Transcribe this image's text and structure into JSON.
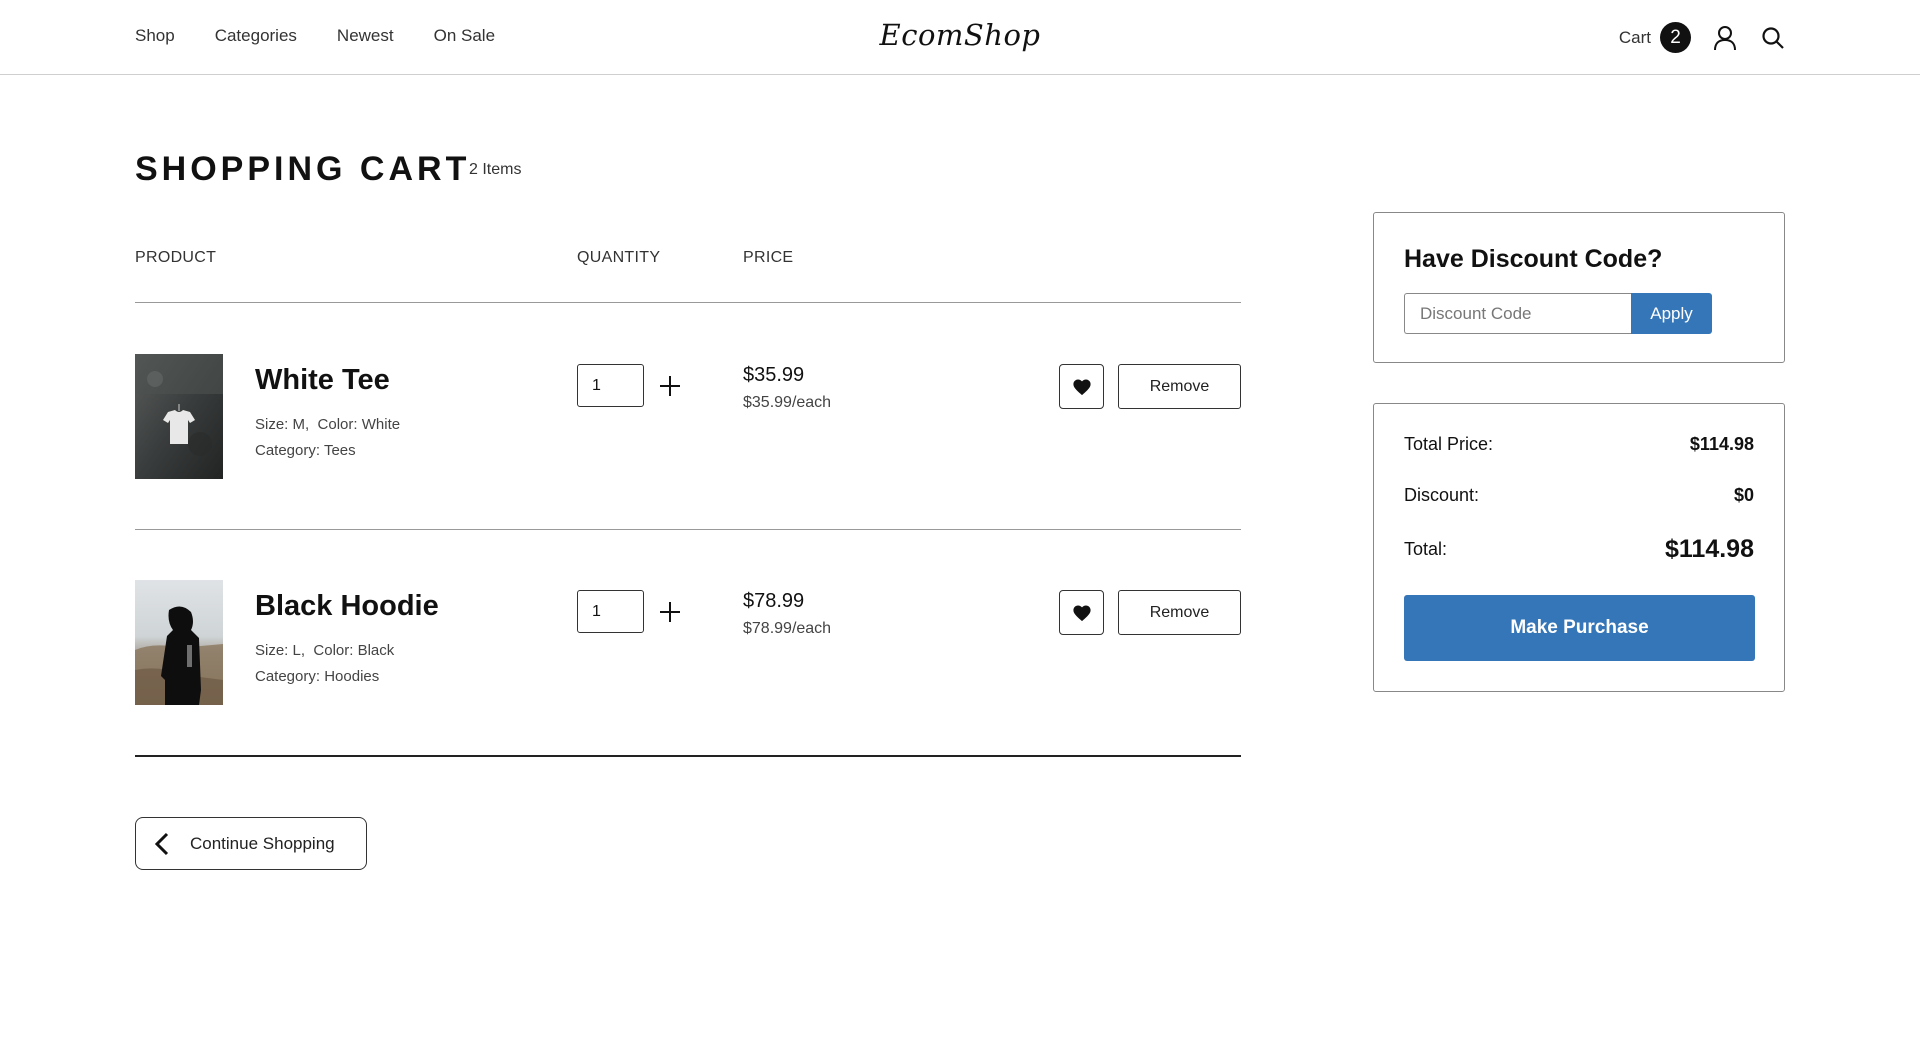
{
  "header": {
    "nav": [
      "Shop",
      "Categories",
      "Newest",
      "On Sale"
    ],
    "logo": "EcomShop",
    "cart_label": "Cart",
    "cart_count": "2",
    "icons": [
      "user-icon",
      "search-icon"
    ]
  },
  "cart": {
    "title": "SHOPPING CART",
    "item_count": "2 Items",
    "columns": {
      "product": "PRODUCT",
      "quantity": "QUANTITY",
      "price": "PRICE"
    },
    "items": [
      {
        "name": "White Tee",
        "size_label": "Size:",
        "size": "M",
        "color_label": "Color:",
        "color": "White",
        "category_label": "Category:",
        "category": "Tees",
        "quantity": "1",
        "price": "$35.99",
        "price_each": "$35.99/each",
        "remove_label": "Remove"
      },
      {
        "name": "Black Hoodie",
        "size_label": "Size:",
        "size": "L",
        "color_label": "Color:",
        "color": "Black",
        "category_label": "Category:",
        "category": "Hoodies",
        "quantity": "1",
        "price": "$78.99",
        "price_each": "$78.99/each",
        "remove_label": "Remove"
      }
    ],
    "continue_label": "Continue Shopping"
  },
  "discount": {
    "title": "Have Discount Code?",
    "placeholder": "Discount Code",
    "apply_label": "Apply"
  },
  "summary": {
    "total_price_label": "Total Price:",
    "total_price": "$114.98",
    "discount_label": "Discount:",
    "discount": "$0",
    "total_label": "Total:",
    "total": "$114.98",
    "purchase_label": "Make Purchase"
  },
  "colors": {
    "accent": "#3576b8",
    "text": "#111111",
    "badge": "#111111"
  }
}
